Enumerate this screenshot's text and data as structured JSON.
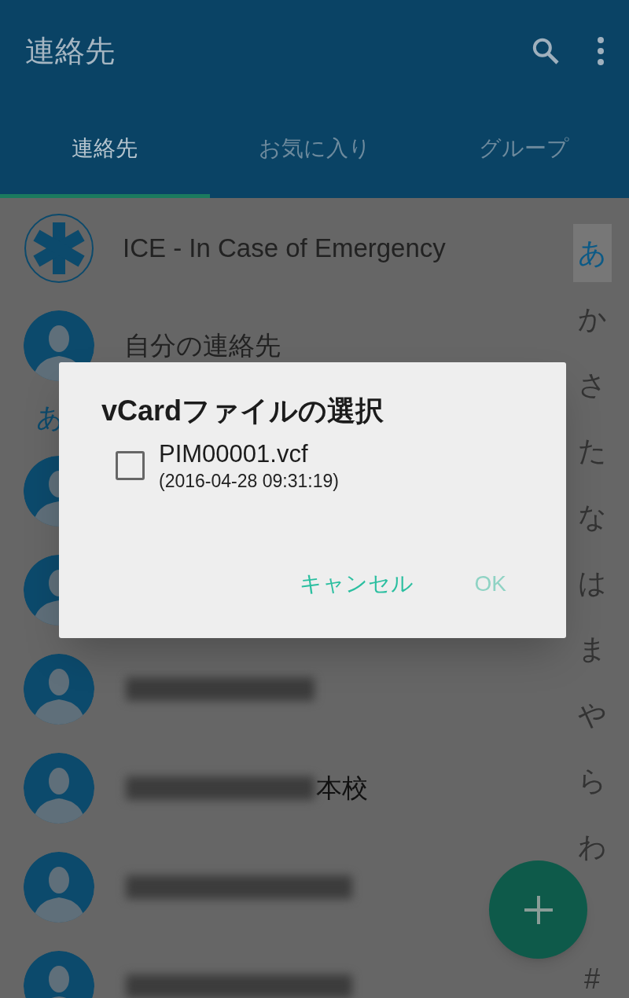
{
  "app_bar": {
    "title": "連絡先"
  },
  "tabs": [
    {
      "label": "連絡先",
      "selected": true
    },
    {
      "label": "お気に入り",
      "selected": false
    },
    {
      "label": "グループ",
      "selected": false
    }
  ],
  "contacts": [
    {
      "kind": "ice",
      "name": "ICE - In Case of Emergency"
    },
    {
      "kind": "contact",
      "name": "自分の連絡先"
    },
    {
      "kind": "header",
      "name": "あ"
    },
    {
      "kind": "covered"
    },
    {
      "kind": "covered"
    },
    {
      "kind": "blurred"
    },
    {
      "kind": "blurred",
      "visible_text": "本校"
    },
    {
      "kind": "blurred"
    },
    {
      "kind": "blurred"
    }
  ],
  "index": [
    {
      "label": "あ",
      "selected": true
    },
    {
      "label": "か",
      "selected": false
    },
    {
      "label": "さ",
      "selected": false
    },
    {
      "label": "た",
      "selected": false
    },
    {
      "label": "な",
      "selected": false
    },
    {
      "label": "は",
      "selected": false
    },
    {
      "label": "ま",
      "selected": false
    },
    {
      "label": "や",
      "selected": false
    },
    {
      "label": "ら",
      "selected": false
    },
    {
      "label": "わ",
      "selected": false
    },
    {
      "label": "#",
      "selected": false
    }
  ],
  "dialog": {
    "title": "vCardファイルの選択",
    "files": [
      {
        "name": "PIM00001.vcf",
        "date": "(2016-04-28 09:31:19)",
        "checked": false
      }
    ],
    "buttons": [
      {
        "label": "キャンセル",
        "disabled": false
      },
      {
        "label": "OK",
        "disabled": true
      }
    ]
  }
}
